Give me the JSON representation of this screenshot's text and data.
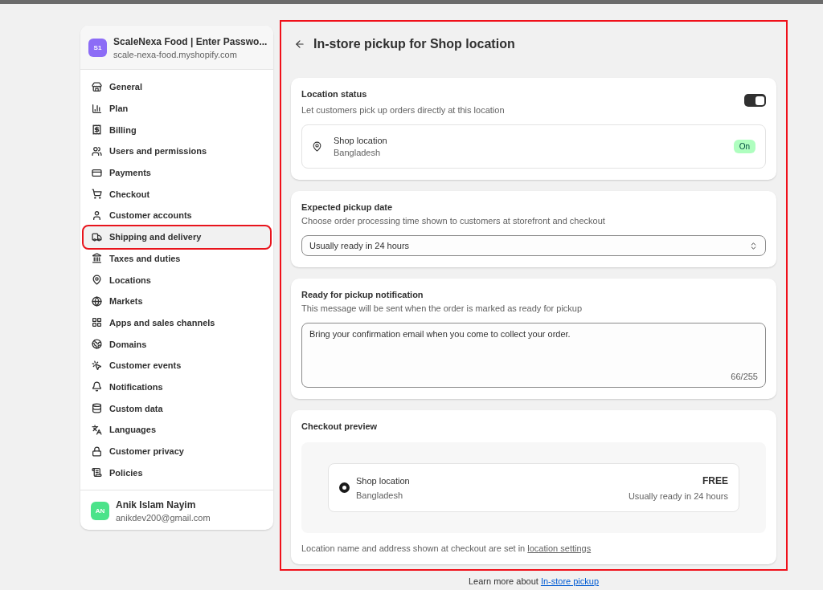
{
  "store": {
    "initials": "S1",
    "name": "ScaleNexa Food | Enter Passwo...",
    "domain": "scale-nexa-food.myshopify.com"
  },
  "nav": [
    {
      "label": "General",
      "selected": false
    },
    {
      "label": "Plan",
      "selected": false
    },
    {
      "label": "Billing",
      "selected": false
    },
    {
      "label": "Users and permissions",
      "selected": false
    },
    {
      "label": "Payments",
      "selected": false
    },
    {
      "label": "Checkout",
      "selected": false
    },
    {
      "label": "Customer accounts",
      "selected": false
    },
    {
      "label": "Shipping and delivery",
      "selected": true
    },
    {
      "label": "Taxes and duties",
      "selected": false
    },
    {
      "label": "Locations",
      "selected": false
    },
    {
      "label": "Markets",
      "selected": false
    },
    {
      "label": "Apps and sales channels",
      "selected": false
    },
    {
      "label": "Domains",
      "selected": false
    },
    {
      "label": "Customer events",
      "selected": false
    },
    {
      "label": "Notifications",
      "selected": false
    },
    {
      "label": "Custom data",
      "selected": false
    },
    {
      "label": "Languages",
      "selected": false
    },
    {
      "label": "Customer privacy",
      "selected": false
    },
    {
      "label": "Policies",
      "selected": false
    }
  ],
  "user": {
    "initials": "AN",
    "name": "Anik Islam Nayim",
    "email": "anikdev200@gmail.com"
  },
  "page": {
    "title": "In-store pickup for Shop location"
  },
  "location_status": {
    "title": "Location status",
    "description": "Let customers pick up orders directly at this location",
    "on": true,
    "location": {
      "name": "Shop location",
      "country": "Bangladesh",
      "badge": "On"
    }
  },
  "pickup_date": {
    "title": "Expected pickup date",
    "description": "Choose order processing time shown to customers at storefront and checkout",
    "value": "Usually ready in 24 hours"
  },
  "notification": {
    "title": "Ready for pickup notification",
    "description": "This message will be sent when the order is marked as ready for pickup",
    "value": "Bring your confirmation email when you come to collect your order.",
    "counter": "66/255"
  },
  "checkout_preview": {
    "title": "Checkout preview",
    "option": {
      "name": "Shop location",
      "country": "Bangladesh",
      "price": "FREE",
      "eta": "Usually ready in 24 hours",
      "selected": true
    },
    "note": "Location name and address shown at checkout are set in",
    "note_link": "location settings"
  },
  "footer": {
    "text": "Learn more about",
    "link": "In-store pickup"
  }
}
